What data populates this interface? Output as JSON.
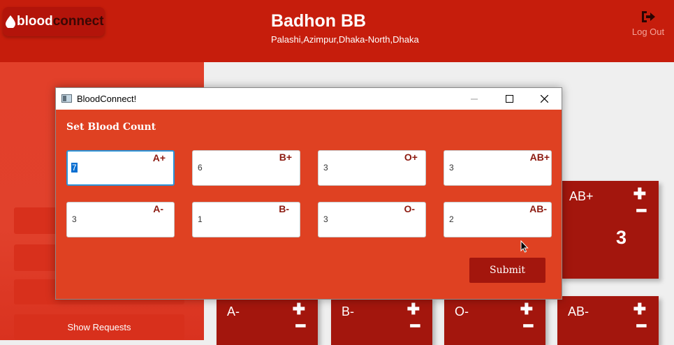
{
  "header": {
    "logo_part1": "blood",
    "logo_part2": "connect",
    "org_name": "Badhon BB",
    "org_address": "Palashi,Azimpur,Dhaka-North,Dhaka",
    "logout_label": "Log Out"
  },
  "sidebar": {
    "show_requests_label": "Show Requests"
  },
  "cards": [
    {
      "group": "AB+",
      "count": "3"
    },
    {
      "group": "A-"
    },
    {
      "group": "B-"
    },
    {
      "group": "O-"
    },
    {
      "group": "AB-"
    }
  ],
  "dialog": {
    "window_title": "BloodConnect!",
    "heading": "Set Blood Count",
    "fields": [
      {
        "group": "A+",
        "value": "7"
      },
      {
        "group": "B+",
        "value": "6"
      },
      {
        "group": "O+",
        "value": "3"
      },
      {
        "group": "AB+",
        "value": "3"
      },
      {
        "group": "A-",
        "value": "3"
      },
      {
        "group": "B-",
        "value": "1"
      },
      {
        "group": "O-",
        "value": "3"
      },
      {
        "group": "AB-",
        "value": "2"
      }
    ],
    "submit_label": "Submit"
  },
  "colors": {
    "header": "#c61d0c",
    "sidebar": "#e1412c",
    "card": "#a3160d",
    "dialog": "#df4122",
    "focus": "#2a93d8"
  }
}
